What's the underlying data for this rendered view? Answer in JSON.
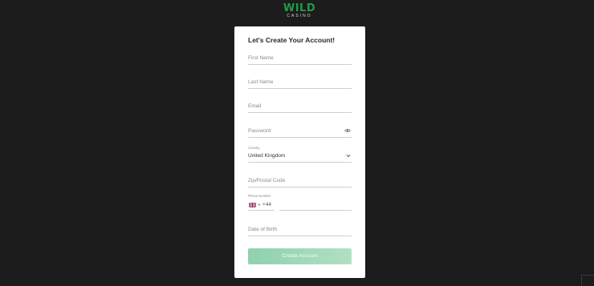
{
  "logo": {
    "main": "WILD",
    "sub": "CASINO"
  },
  "form": {
    "title": "Let's Create Your Account!",
    "first_name": {
      "placeholder": "First Name"
    },
    "last_name": {
      "placeholder": "Last Name"
    },
    "email": {
      "placeholder": "Email"
    },
    "password": {
      "placeholder": "Password"
    },
    "country": {
      "label": "Country",
      "value": "United Kingdom"
    },
    "zip": {
      "placeholder": "Zip/Postal Code"
    },
    "phone": {
      "label": "Phone Number",
      "dial_code": "+44"
    },
    "dob": {
      "placeholder": "Date of Birth"
    },
    "submit_label": "Create Account"
  },
  "icons": {
    "password_toggle": "eye-icon",
    "country_dropdown": "chevron-down-icon",
    "phone_flag": "uk-flag-icon"
  },
  "colors": {
    "background": "#1c1c1c",
    "card": "#ffffff",
    "brand_green": "#1f9c45",
    "button": "#9fd8b9"
  }
}
